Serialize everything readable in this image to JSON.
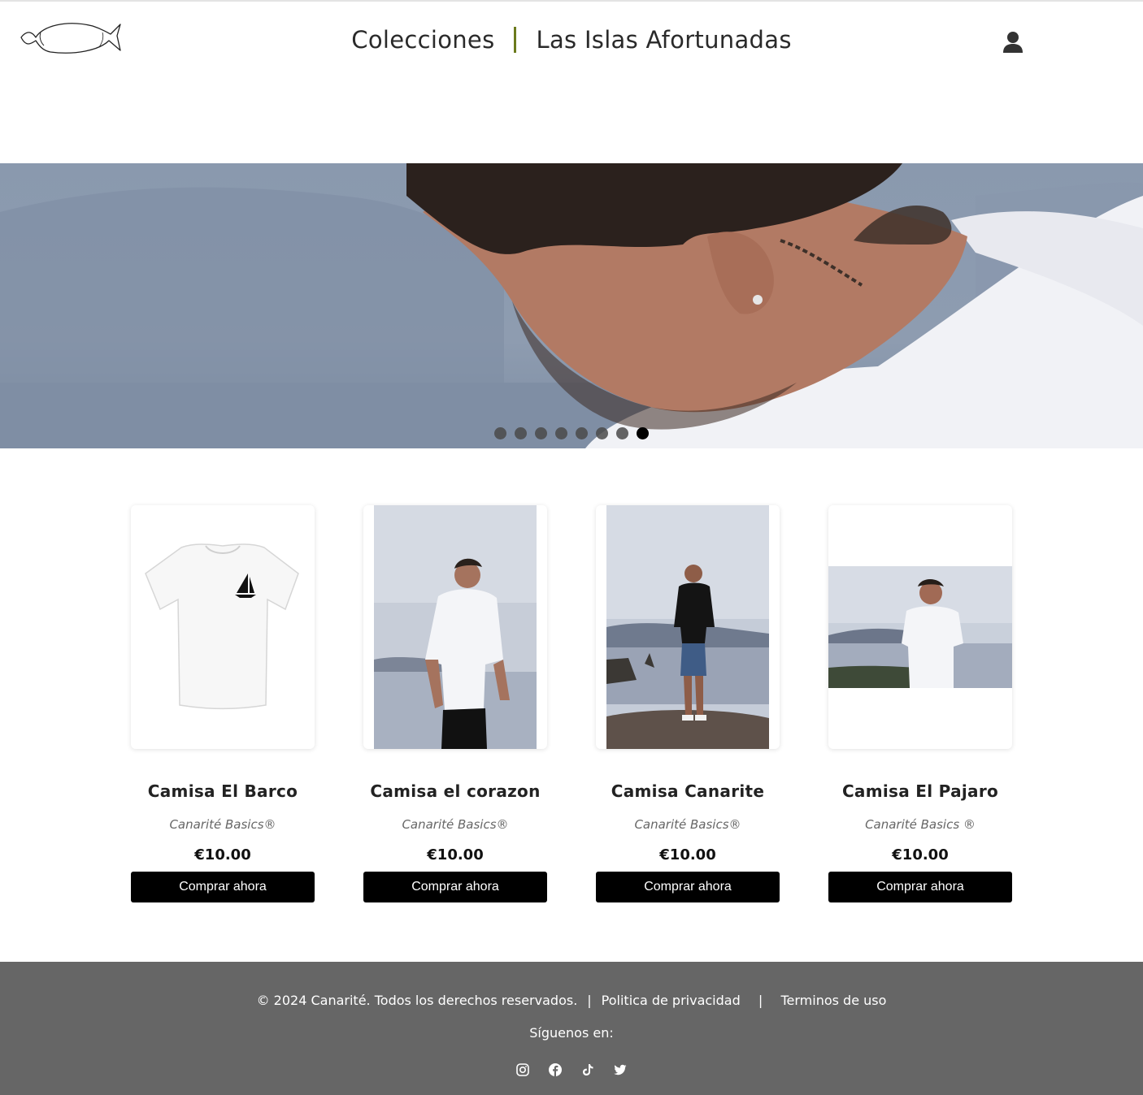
{
  "header": {
    "nav": [
      "Colecciones",
      "Las Islas Afortunadas"
    ],
    "logo_icon": "fish-logo-icon",
    "user_icon": "user-icon"
  },
  "hero": {
    "slides_count": 8,
    "active_slide": 8
  },
  "products": [
    {
      "name": "Camisa El Barco",
      "brand": "Canarité Basics®",
      "price": "€10.00",
      "cta": "Comprar ahora"
    },
    {
      "name": "Camisa el corazon",
      "brand": "Canarité Basics®",
      "price": "€10.00",
      "cta": "Comprar ahora"
    },
    {
      "name": "Camisa Canarite",
      "brand": "Canarité Basics®",
      "price": "€10.00",
      "cta": "Comprar ahora"
    },
    {
      "name": "Camisa El Pajaro",
      "brand": "Canarité Basics ®",
      "price": "€10.00",
      "cta": "Comprar ahora"
    }
  ],
  "footer": {
    "copyright": "© 2024 Canarité. Todos los derechos reservados.",
    "privacy": "Politica de privacidad",
    "terms": "Terminos de uso",
    "follow": "Síguenos en:",
    "social_icons": [
      "instagram-icon",
      "facebook-icon",
      "tiktok-icon",
      "twitter-icon"
    ]
  }
}
